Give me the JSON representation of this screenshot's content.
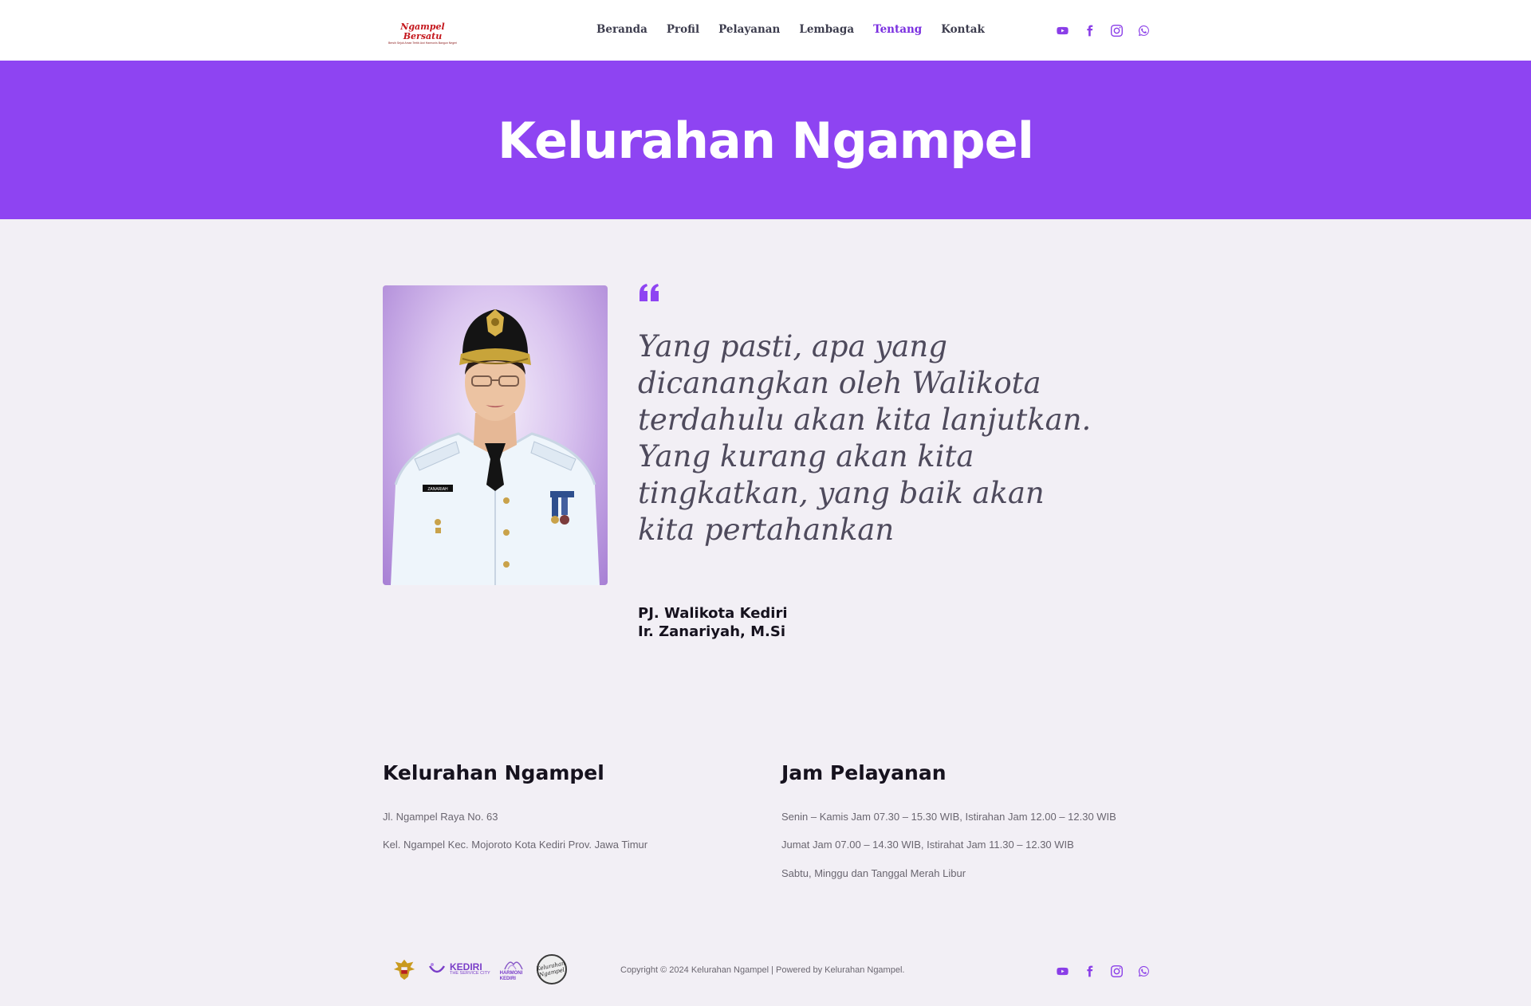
{
  "header": {
    "logo_text": "Ngampel Bersatu",
    "logo_tagline": "Bersih Sejuk Aman Tertib Asri Harmonis Bangun Negeri",
    "nav": [
      {
        "label": "Beranda",
        "active": false
      },
      {
        "label": "Profil",
        "active": false
      },
      {
        "label": "Pelayanan",
        "active": false
      },
      {
        "label": "Lembaga",
        "active": false
      },
      {
        "label": "Tentang",
        "active": true
      },
      {
        "label": "Kontak",
        "active": false
      }
    ],
    "social_icons": [
      "youtube-icon",
      "facebook-icon",
      "instagram-icon",
      "whatsapp-icon"
    ]
  },
  "hero": {
    "title": "Kelurahan Ngampel"
  },
  "quote": {
    "text": "Yang pasti, apa yang dicanangkan oleh Walikota terdahulu akan kita lanjutkan. Yang kurang akan kita tingkatkan, yang baik akan kita pertahankan",
    "author_title": "PJ. Walikota Kediri",
    "author_name": "Ir. Zanariyah, M.Si",
    "name_tag": "ZANARIAH"
  },
  "info": {
    "address": {
      "title": "Kelurahan Ngampel",
      "lines": [
        "Jl. Ngampel Raya No. 63",
        "Kel. Ngampel Kec. Mojoroto Kota Kediri Prov. Jawa Timur"
      ]
    },
    "hours": {
      "title": "Jam Pelayanan",
      "lines": [
        "Senin – Kamis Jam 07.30 – 15.30 WIB, Istirahan Jam 12.00 – 12.30 WIB",
        "Jumat Jam 07.00 – 14.30 WIB, Istirahat Jam 11.30 – 12.30 WIB",
        "Sabtu, Minggu dan Tanggal Merah Libur"
      ]
    }
  },
  "footer": {
    "logos": {
      "kediri": "KEDIRI",
      "kediri_sub": "THE SERVICE CITY",
      "harmoni": "HARMONI KEDIRI",
      "seal": "Kelurahan Ngampel"
    },
    "copyright": "Copyright © 2024 Kelurahan Ngampel | Powered by Kelurahan Ngampel."
  },
  "colors": {
    "accent": "#8e44f2",
    "nav_active": "#7a2fe0",
    "page_bg": "#f2eff5",
    "logo_red": "#c4161c"
  }
}
